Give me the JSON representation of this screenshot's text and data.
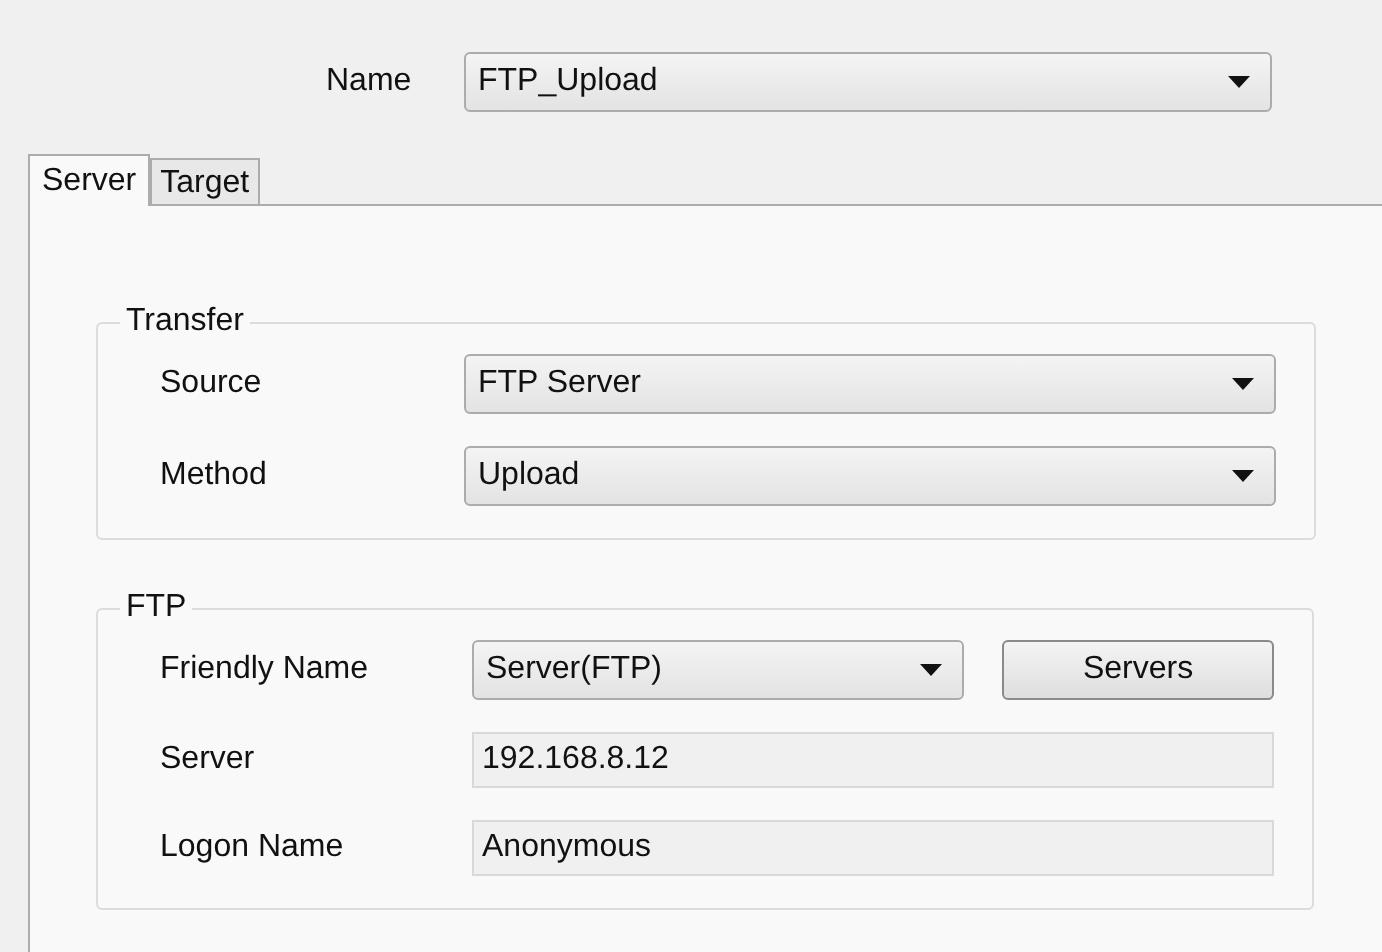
{
  "name_field": {
    "label": "Name",
    "value": "FTP_Upload"
  },
  "tabs": [
    {
      "label": "Server",
      "selected": true
    },
    {
      "label": "Target",
      "selected": false
    }
  ],
  "groups": [
    {
      "title": "Transfer",
      "rows": [
        {
          "kind": "dropdown",
          "label": "Source",
          "value": "FTP Server"
        },
        {
          "kind": "dropdown",
          "label": "Method",
          "value": "Upload"
        }
      ]
    },
    {
      "title": "FTP",
      "rows": [
        {
          "kind": "dropdown_button",
          "label": "Friendly Name",
          "value": "Server(FTP)",
          "button": "Servers"
        },
        {
          "kind": "text",
          "label": "Server",
          "value": "192.168.8.12"
        },
        {
          "kind": "text",
          "label": "Logon Name",
          "value": "Anonymous"
        }
      ]
    }
  ]
}
